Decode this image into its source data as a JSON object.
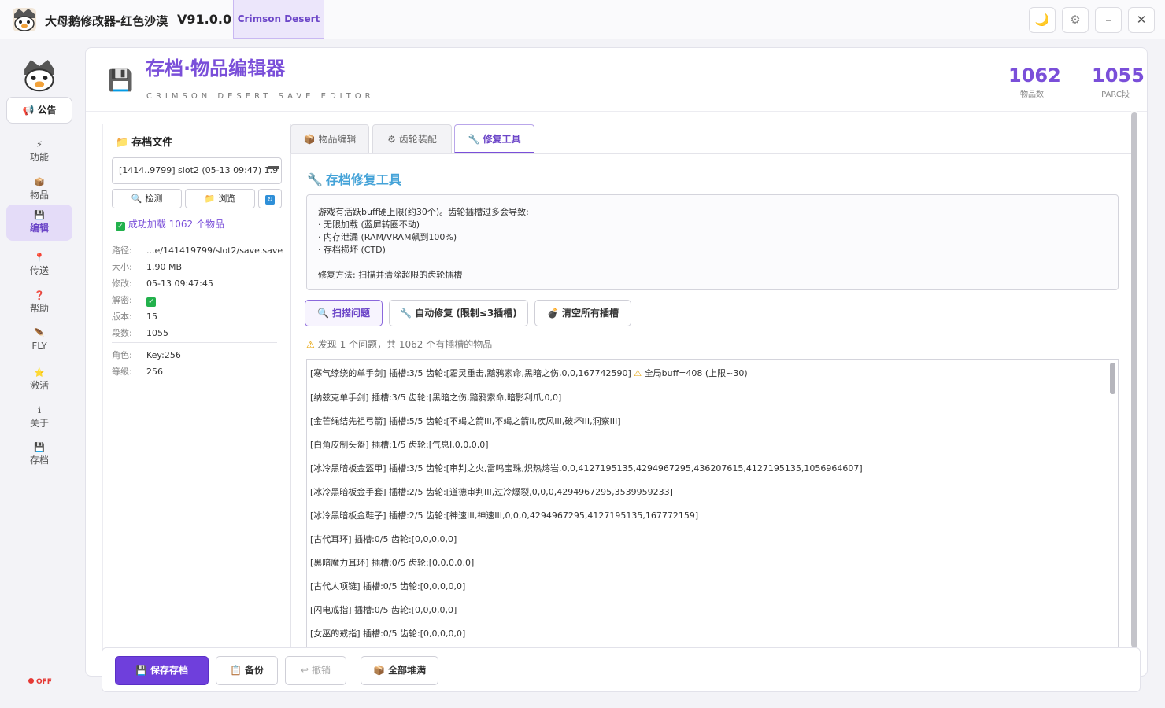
{
  "window": {
    "title": "大母鹅修改器-红色沙漠",
    "version": "V91.0.0",
    "game_tab": "Crimson Desert",
    "theme_icon": "moon-icon",
    "settings_icon": "gear-icon",
    "minimize_icon": "minimize-icon",
    "close_icon": "close-icon"
  },
  "sidebar": {
    "notice": "公告",
    "items": [
      {
        "label": "功能",
        "icon": "bolt-icon",
        "glyph": "⚡"
      },
      {
        "label": "物品",
        "icon": "box-icon",
        "glyph": "📦"
      },
      {
        "label": "编辑",
        "icon": "floppy-icon",
        "glyph": "💾"
      },
      {
        "label": "传送",
        "icon": "pin-icon",
        "glyph": "📍"
      },
      {
        "label": "帮助",
        "icon": "question-icon",
        "glyph": "❓"
      },
      {
        "label": "FLY",
        "icon": "feather-icon",
        "glyph": "🪶"
      },
      {
        "label": "激活",
        "icon": "star-icon",
        "glyph": "⭐"
      },
      {
        "label": "关于",
        "icon": "info-icon",
        "glyph": "ℹ"
      },
      {
        "label": "存档",
        "icon": "floppy-icon",
        "glyph": "💾"
      }
    ],
    "status": "OFF"
  },
  "header": {
    "title": "存档·物品编辑器",
    "subtitle": "CRIMSON DESERT SAVE EDITOR",
    "stats": [
      {
        "value": "1062",
        "label": "物品数"
      },
      {
        "value": "1055",
        "label": "PARC段"
      }
    ]
  },
  "save_panel": {
    "title": "存档文件",
    "selected_file": "[1414..9799] slot2 (05-13 09:47) 1.9",
    "detect_label": "检测",
    "browse_label": "浏览",
    "load_status": "成功加载 1062 个物品",
    "info": [
      {
        "key": "路径:",
        "value": "...e/141419799/slot2/save.save"
      },
      {
        "key": "大小:",
        "value": "1.90 MB"
      },
      {
        "key": "修改:",
        "value": "05-13 09:47:45"
      },
      {
        "key": "解密:",
        "value": "✓"
      },
      {
        "key": "版本:",
        "value": "15"
      },
      {
        "key": "段数:",
        "value": "1055"
      }
    ],
    "char_info": [
      {
        "key": "角色:",
        "value": "Key:256"
      },
      {
        "key": "等级:",
        "value": "256"
      }
    ]
  },
  "tabs": [
    {
      "label": "物品编辑",
      "icon": "box-icon",
      "glyph": "📦"
    },
    {
      "label": "齿轮装配",
      "icon": "gear-icon",
      "glyph": "⚙"
    },
    {
      "label": "修复工具",
      "icon": "wrench-icon",
      "glyph": "🔧"
    }
  ],
  "repair": {
    "title": "存档修复工具",
    "info_lines": [
      "游戏有活跃buff硬上限(约30个)。齿轮插槽过多会导致:",
      "· 无限加载 (蓝屏转圈不动)",
      "· 内存泄漏 (RAM/VRAM飙到100%)",
      "· 存档损坏 (CTD)",
      "",
      "修复方法: 扫描并清除超限的齿轮插槽"
    ],
    "scan_label": "扫描问题",
    "autofix_label": "自动修复 (限制≤3插槽)",
    "clear_label": "清空所有插槽",
    "found_text": "发现 1 个问题，共 1062 个有插槽的物品",
    "results": [
      {
        "text": "[寒气缭绕的单手剑] 插槽:3/5 齿轮:[霜灵重击,黯鸦索命,黑暗之伤,0,0,167742590]",
        "warn": "全局buff=408 (上限~30)"
      },
      {
        "text": "[纳兹克单手剑] 插槽:3/5 齿轮:[黑暗之伤,黯鸦索命,暗影利爪,0,0]",
        "warn": ""
      },
      {
        "text": "[金芒绳结先祖弓箭] 插槽:5/5 齿轮:[不竭之箭III,不竭之箭II,疾风III,破坏III,洞察III]",
        "warn": ""
      },
      {
        "text": "[白角皮制头盔] 插槽:1/5 齿轮:[气息I,0,0,0,0]",
        "warn": ""
      },
      {
        "text": "[冰冷黑暗板金盔甲] 插槽:3/5 齿轮:[审判之火,雷鸣宝珠,炽热熔岩,0,0,4127195135,4294967295,436207615,4127195135,1056964607]",
        "warn": ""
      },
      {
        "text": "[冰冷黑暗板金手套] 插槽:2/5 齿轮:[道德审判III,过冷爆裂,0,0,0,4294967295,3539959233]",
        "warn": ""
      },
      {
        "text": "[冰冷黑暗板金鞋子] 插槽:2/5 齿轮:[神速III,神速III,0,0,0,4294967295,4127195135,167772159]",
        "warn": ""
      },
      {
        "text": "[古代耳环] 插槽:0/5 齿轮:[0,0,0,0,0]",
        "warn": ""
      },
      {
        "text": "[黑暗魔力耳环] 插槽:0/5 齿轮:[0,0,0,0,0]",
        "warn": ""
      },
      {
        "text": "[古代人项链] 插槽:0/5 齿轮:[0,0,0,0,0]",
        "warn": ""
      },
      {
        "text": "[闪电戒指] 插槽:0/5 齿轮:[0,0,0,0,0]",
        "warn": ""
      },
      {
        "text": "[女巫的戒指] 插槽:0/5 齿轮:[0,0,0,0,0]",
        "warn": ""
      }
    ]
  },
  "footer": {
    "save_label": "保存存档",
    "backup_label": "备份",
    "undo_label": "撤销",
    "fill_label": "全部堆满"
  },
  "colors": {
    "accent": "#7a4fd9",
    "repair_title": "#45a3d8",
    "ok": "#22b14c",
    "off": "#e53935"
  }
}
